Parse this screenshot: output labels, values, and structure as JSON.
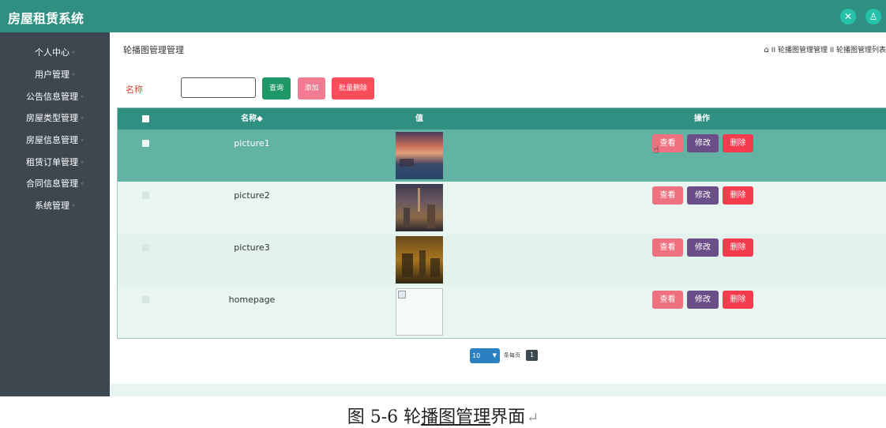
{
  "app": {
    "title": "房屋租赁系统"
  },
  "topbar": {
    "icons": [
      "fullscreen-icon",
      "user-icon"
    ],
    "accent": "#25c1a9",
    "bar_color": "#2f8f80"
  },
  "sidebar": {
    "items": [
      {
        "label": "个人中心"
      },
      {
        "label": "用户管理"
      },
      {
        "label": "公告信息管理"
      },
      {
        "label": "房屋类型管理"
      },
      {
        "label": "房屋信息管理"
      },
      {
        "label": "租赁订单管理"
      },
      {
        "label": "合同信息管理"
      },
      {
        "label": "系统管理"
      }
    ]
  },
  "page": {
    "title": "轮播图管理管理",
    "breadcrumb": "II 轮播图管理管理 II 轮播图管理列表"
  },
  "search": {
    "label": "名称",
    "value": "",
    "placeholder": "",
    "search_button": "查询",
    "add_button": "添加",
    "batch_delete_button": "批量删除"
  },
  "table": {
    "headers": {
      "name": "名称◆",
      "value": "值",
      "actions": "操作"
    },
    "rows": [
      {
        "name": "picture1",
        "image": "sunset-lake"
      },
      {
        "name": "picture2",
        "image": "city-night"
      },
      {
        "name": "picture3",
        "image": "castle-dusk"
      },
      {
        "name": "homepage",
        "image": "broken-image"
      }
    ],
    "actions": {
      "view": "查看",
      "edit": "修改",
      "delete": "删除"
    }
  },
  "pagination": {
    "page_size": "10",
    "per_page_label": "条每页",
    "current_page": "1"
  },
  "caption": {
    "prefix": "图 5-6 轮",
    "underlined": "播图管理",
    "suffix": "界面",
    "return_mark": "↵"
  }
}
